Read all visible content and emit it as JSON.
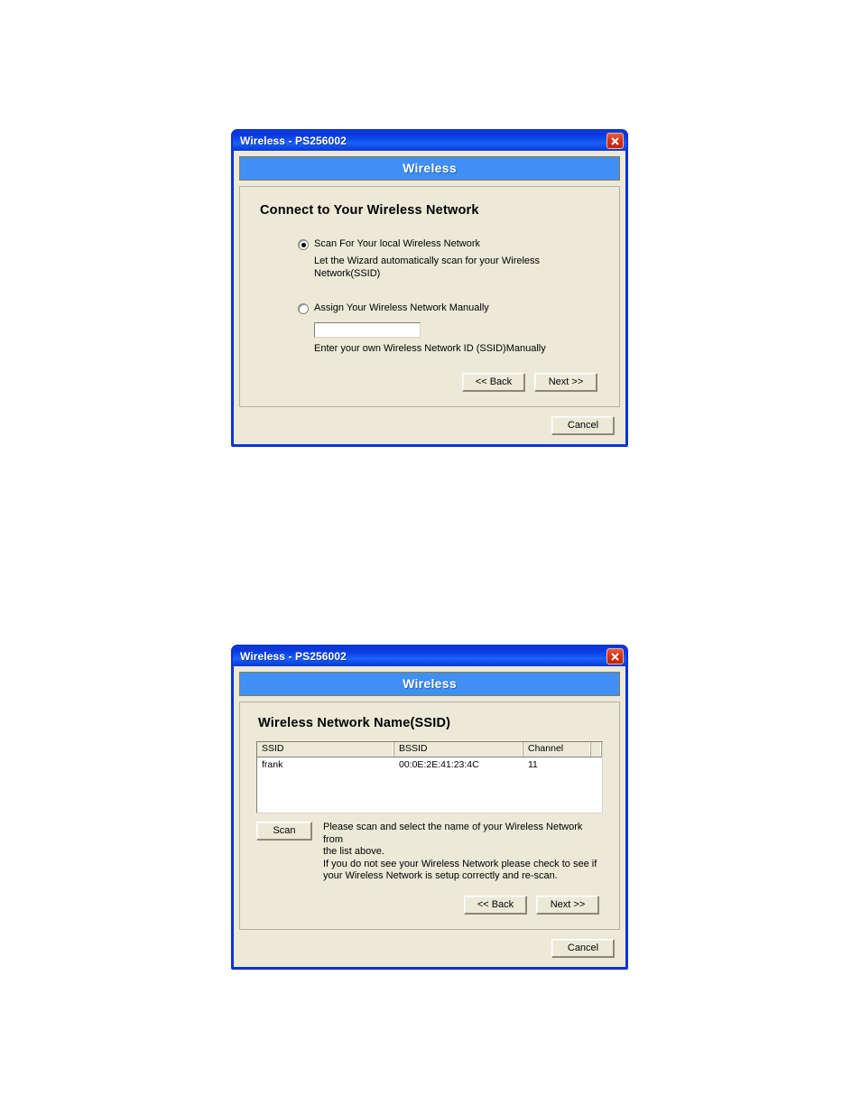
{
  "dialog1": {
    "titlebar": {
      "app": "Wireless",
      "separator": " - ",
      "device": "PS256002"
    },
    "banner": "Wireless",
    "heading": "Connect to Your Wireless Network",
    "options": [
      {
        "label": "Scan For Your local Wireless Network",
        "help": "Let the Wizard automatically scan for your Wireless Network(SSID)",
        "selected": true
      },
      {
        "label": "Assign Your Wireless Network Manually",
        "help": "Enter your own Wireless Network ID (SSID)Manually",
        "selected": false
      }
    ],
    "ssid_input": {
      "value": "",
      "placeholder": ""
    },
    "buttons": {
      "back": "<< Back",
      "next": "Next >>",
      "cancel": "Cancel"
    }
  },
  "dialog2": {
    "titlebar": {
      "app": "Wireless",
      "separator": " - ",
      "device": "PS256002"
    },
    "banner": "Wireless",
    "heading": "Wireless Network Name(SSID)",
    "table": {
      "columns": [
        "SSID",
        "BSSID",
        "Channel",
        ""
      ],
      "rows": [
        {
          "ssid": "frank",
          "bssid": "00:0E:2E:41:23:4C",
          "channel": "11"
        }
      ]
    },
    "scan_button": "Scan",
    "instructions": [
      "Please scan and select the name of your Wireless Network from",
      "the list above.",
      "If you do not see your Wireless Network please check to see if",
      "your Wireless Network is setup correctly and re-scan."
    ],
    "buttons": {
      "back": "<< Back",
      "next": "Next >>",
      "cancel": "Cancel"
    }
  },
  "colors": {
    "titlebar_blue": "#0a35da",
    "banner_blue": "#3f8ff5",
    "client_beige": "#ece9d8",
    "close_red": "#d6321a",
    "page_background": "#ffffff"
  }
}
